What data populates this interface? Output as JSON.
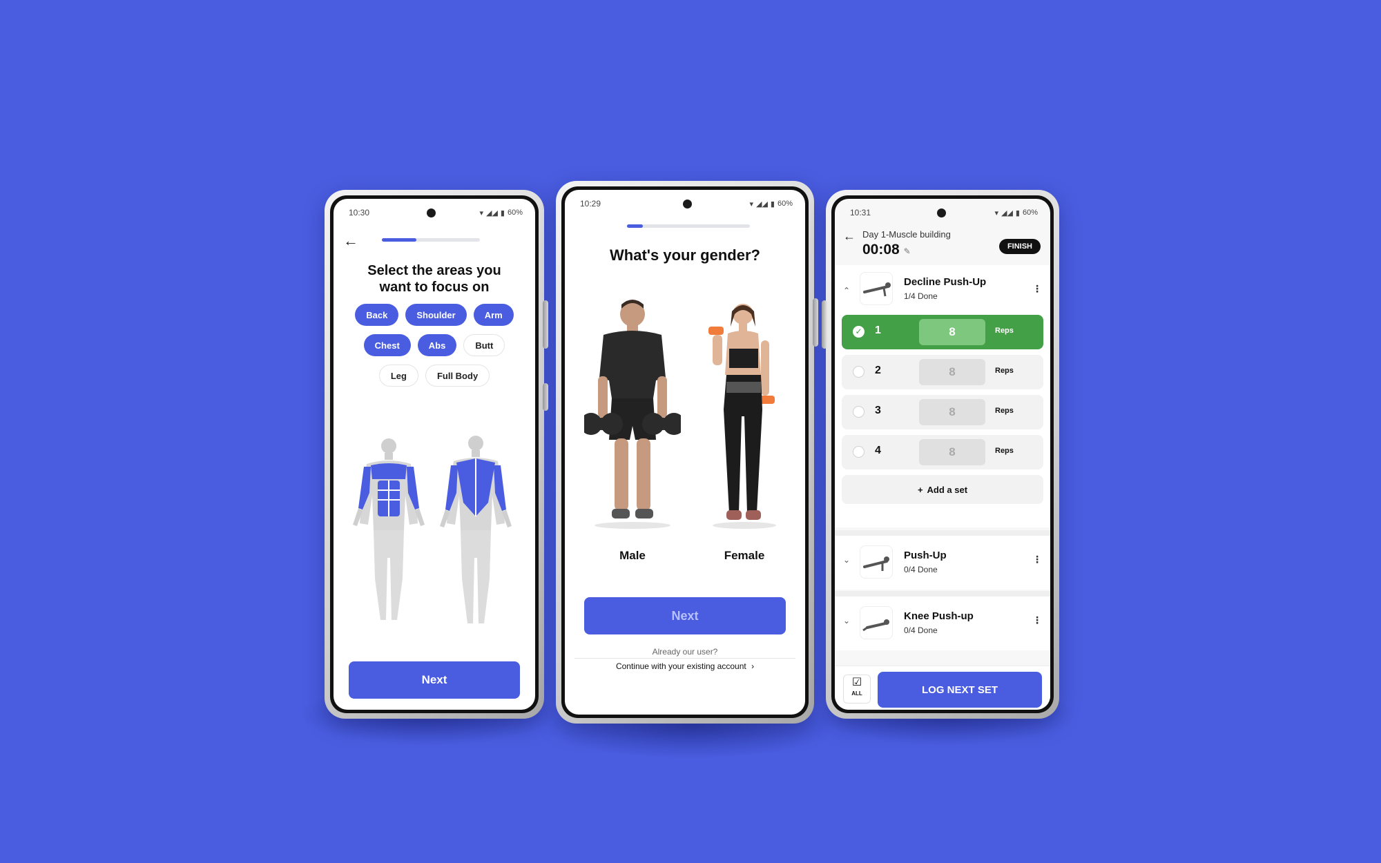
{
  "colors": {
    "background": "#4a5de0",
    "accent": "#4a5de0",
    "success": "#43a047",
    "dark": "#111111"
  },
  "phone_focus": {
    "status": {
      "time": "10:30",
      "battery": "60%"
    },
    "progress": 0.35,
    "back_icon": "arrow-left-icon",
    "title": "Select the areas you want to focus on",
    "chips": [
      [
        {
          "label": "Back",
          "selected": true
        },
        {
          "label": "Shoulder",
          "selected": true
        },
        {
          "label": "Arm",
          "selected": true
        }
      ],
      [
        {
          "label": "Chest",
          "selected": true
        },
        {
          "label": "Abs",
          "selected": true
        },
        {
          "label": "Butt",
          "selected": false
        }
      ],
      [
        {
          "label": "Leg",
          "selected": false
        },
        {
          "label": "Full Body",
          "selected": false
        }
      ]
    ],
    "next_label": "Next"
  },
  "phone_gender": {
    "status": {
      "time": "10:29",
      "battery": "60%"
    },
    "progress": 0.13,
    "title": "What's your gender?",
    "options": [
      {
        "label": "Male"
      },
      {
        "label": "Female"
      }
    ],
    "next_label": "Next",
    "already_text": "Already our user?",
    "continue_text": "Continue with your existing account"
  },
  "phone_workout": {
    "status": {
      "time": "10:31",
      "battery": "60%"
    },
    "back_icon": "arrow-left-icon",
    "subtitle": "Day 1-Muscle building",
    "timer": "00:08",
    "finish_label": "FINISH",
    "exercises": [
      {
        "name": "Decline Push-Up",
        "done": "1/4 Done",
        "expanded": true,
        "sets": [
          {
            "num": "1",
            "reps": "8",
            "unit": "Reps",
            "completed": true
          },
          {
            "num": "2",
            "reps": "8",
            "unit": "Reps",
            "completed": false
          },
          {
            "num": "3",
            "reps": "8",
            "unit": "Reps",
            "completed": false
          },
          {
            "num": "4",
            "reps": "8",
            "unit": "Reps",
            "completed": false
          }
        ],
        "add_set": "Add a set"
      },
      {
        "name": "Push-Up",
        "done": "0/4 Done",
        "expanded": false
      },
      {
        "name": "Knee Push-up",
        "done": "0/4 Done",
        "expanded": false
      }
    ],
    "all_label": "ALL",
    "log_next_label": "LOG NEXT SET"
  }
}
